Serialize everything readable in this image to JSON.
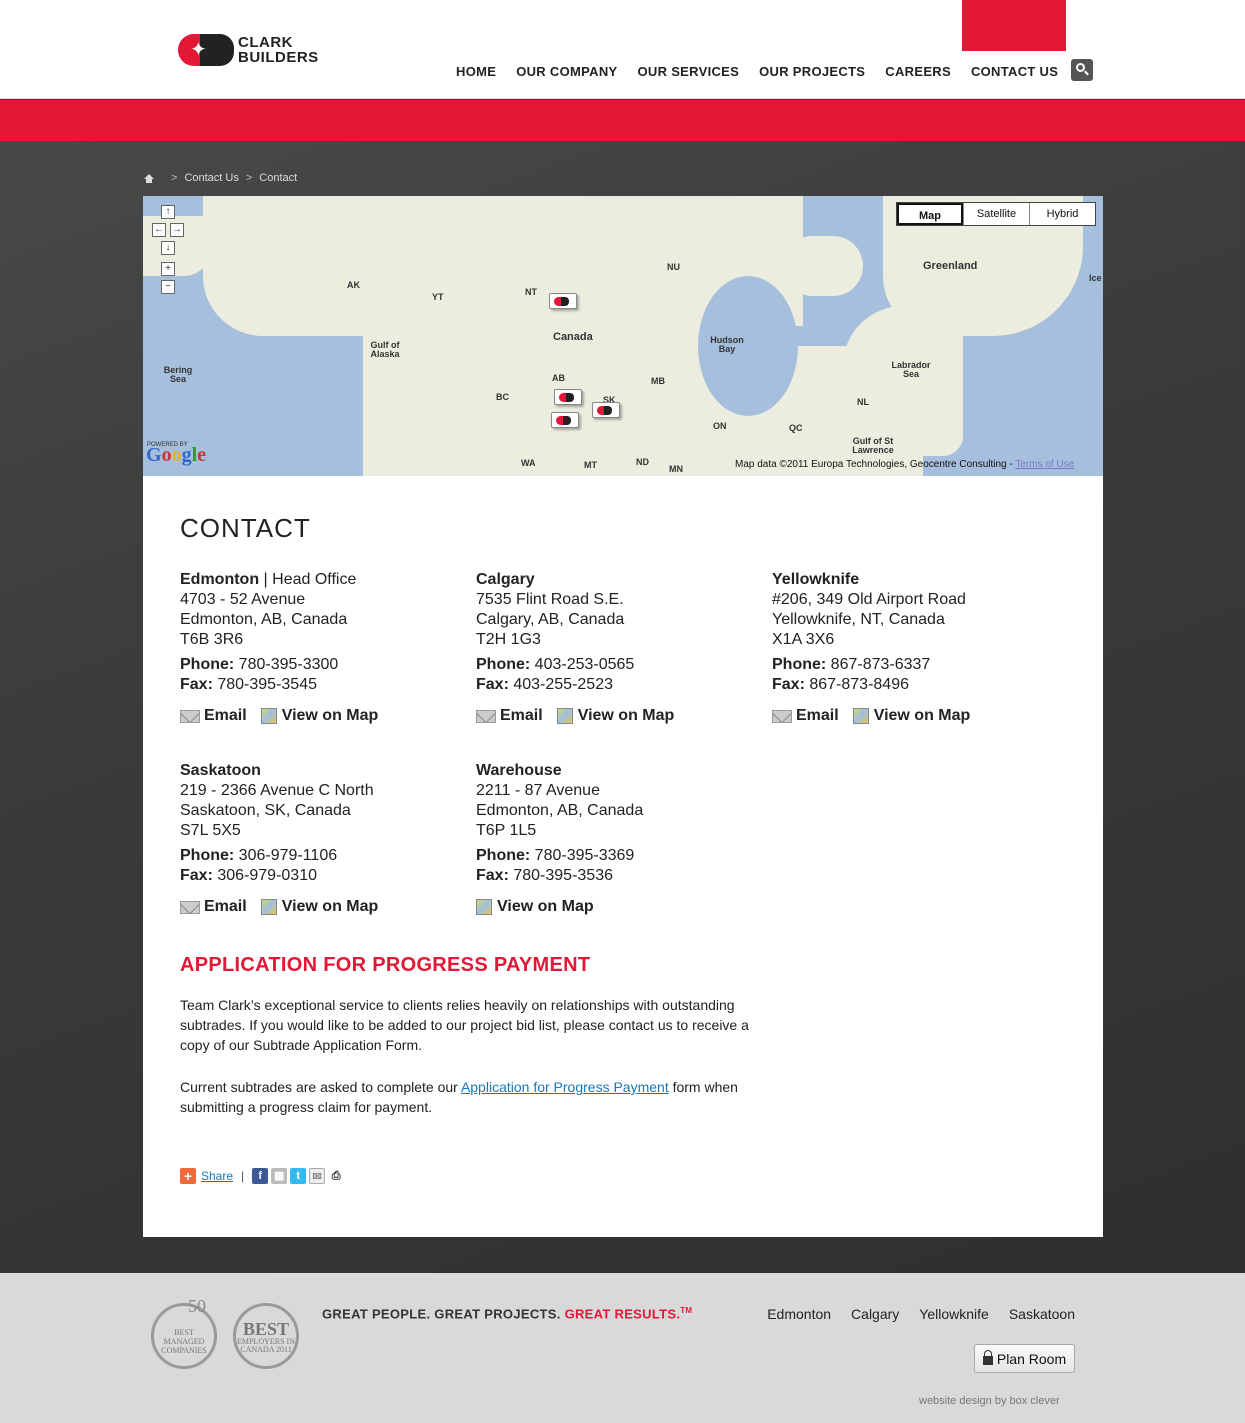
{
  "brand": {
    "logo_text_1": "CLARK",
    "logo_text_2": "BUILDERS"
  },
  "nav": {
    "items": [
      "HOME",
      "OUR COMPANY",
      "OUR SERVICES",
      "OUR PROJECTS",
      "CAREERS",
      "CONTACT US"
    ]
  },
  "breadcrumb": {
    "items": [
      "Contact Us",
      "Contact"
    ]
  },
  "map": {
    "types": [
      "Map",
      "Satellite",
      "Hybrid"
    ],
    "selected_type": "Map",
    "labels": [
      "AK",
      "YT",
      "NT",
      "NU",
      "Canada",
      "Gulf of Alaska",
      "Bering Sea",
      "BC",
      "AB",
      "SK",
      "MB",
      "ON",
      "QC",
      "NL",
      "Hudson Bay",
      "Greenland",
      "Labrador Sea",
      "Gulf of St Lawrence",
      "WA",
      "MT",
      "ND",
      "MN",
      "Ice"
    ],
    "credit": "Map data ©2011 Europa Technologies, Geocentre Consulting - ",
    "terms": "Terms of Use",
    "powered": "POWERED BY",
    "google": "Google"
  },
  "page": {
    "title": "CONTACT",
    "offices": [
      {
        "name": "Edmonton",
        "suffix": " | Head Office",
        "line1": "4703 - 52 Avenue",
        "line2": "Edmonton, AB, Canada",
        "line3": "T6B 3R6",
        "phone": "780-395-3300",
        "fax": "780-395-3545",
        "has_email": true
      },
      {
        "name": "Calgary",
        "suffix": "",
        "line1": "7535 Flint Road S.E.",
        "line2": "Calgary, AB, Canada",
        "line3": "T2H 1G3",
        "phone": "403-253-0565",
        "fax": "403-255-2523",
        "has_email": true
      },
      {
        "name": "Yellowknife",
        "suffix": "",
        "line1": "#206, 349 Old Airport Road",
        "line2": "Yellowknife, NT, Canada",
        "line3": "X1A 3X6",
        "phone": "867-873-6337",
        "fax": "867-873-8496",
        "has_email": true
      },
      {
        "name": "Saskatoon",
        "suffix": "",
        "line1": "219 - 2366 Avenue C North",
        "line2": "Saskatoon, SK, Canada",
        "line3": "S7L 5X5",
        "phone": "306-979-1106",
        "fax": "306-979-0310",
        "has_email": true
      },
      {
        "name": "Warehouse",
        "suffix": "",
        "line1": "2211 - 87 Avenue",
        "line2": "Edmonton, AB, Canada",
        "line3": "T6P 1L5",
        "phone": "780-395-3369",
        "fax": "780-395-3536",
        "has_email": false
      }
    ],
    "phone_label": "Phone:",
    "fax_label": "Fax:",
    "email_label": "Email",
    "map_link_label": "View on Map",
    "app_title": "APPLICATION FOR PROGRESS PAYMENT",
    "para1": "Team Clark’s exceptional service to clients relies heavily on relationships with outstanding subtrades. If you would like to be added to our project bid list, please contact us to receive a copy of our Subtrade Application Form.",
    "para2_before": "Current subtrades are asked to complete our ",
    "para2_link": "Application for Progress Payment",
    "para2_after": " form when submitting a progress claim for payment.",
    "share_label": "Share"
  },
  "footer": {
    "badge1": {
      "number": "50",
      "text": "BEST MANAGED COMPANIES"
    },
    "badge2": {
      "best": "BEST",
      "text": "EMPLOYERS IN CANADA 2011"
    },
    "tagline_a": "GREAT PEOPLE. GREAT PROJECTS. ",
    "tagline_b": "GREAT RESULTS.",
    "tagline_tm": "TM",
    "links": [
      "Edmonton",
      "Calgary",
      "Yellowknife",
      "Saskatoon"
    ],
    "plan_room": "Plan Room",
    "credit": "website design by box clever"
  },
  "colors": {
    "brand_red": "#e21836",
    "link_blue": "#1a78b8",
    "map_water": "#a5bfdd",
    "map_land": "#ededdf"
  }
}
